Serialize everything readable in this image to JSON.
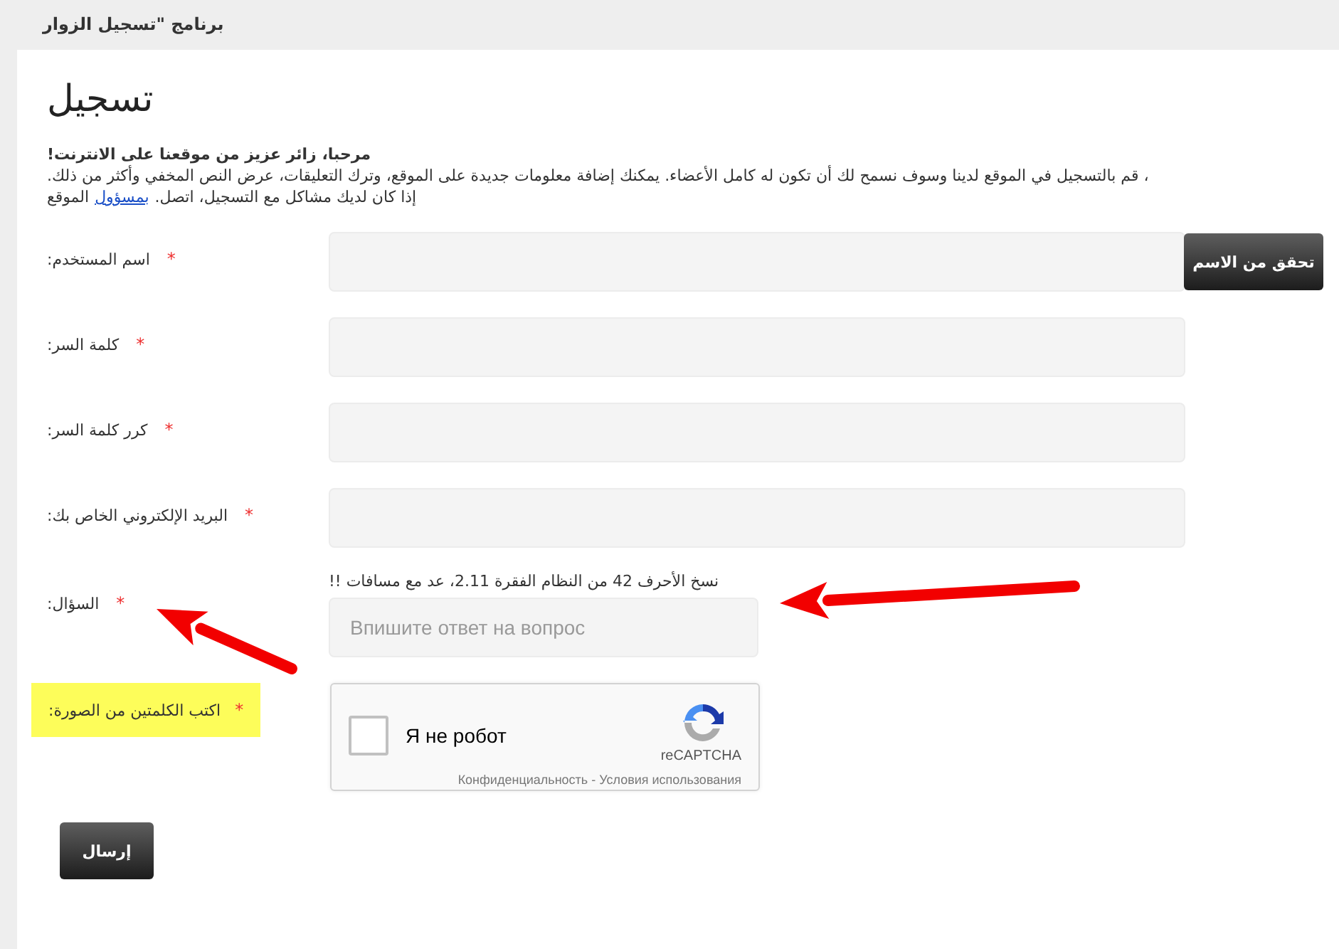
{
  "header": {
    "title": "برنامج \"تسجيل الزوار"
  },
  "page": {
    "heading": "تسجيل",
    "greeting": "!مرحبا، زائر عزيز من موقعنا على الانترنت",
    "intro": ".قم بالتسجيل في الموقع لدينا وسوف نسمح لك أن تكون له كامل الأعضاء. يمكنك إضافة معلومات جديدة على الموقع، وترك التعليقات، عرض النص المخفي وأكثر من ذلك ،",
    "contact": {
      "before": ".إذا كان لديك مشاكل مع التسجيل، اتصل ",
      "link": "بمسؤول",
      "after": " الموقع"
    }
  },
  "fields": [
    {
      "kind": "text",
      "label": ":اسم المستخدم",
      "required": "*",
      "highlighted": false,
      "action": "تحقق من الاسم"
    },
    {
      "kind": "text",
      "label": ":كلمة السر",
      "required": "*",
      "highlighted": false
    },
    {
      "kind": "text",
      "label": ":كرر كلمة السر",
      "required": "*",
      "highlighted": false
    },
    {
      "kind": "text",
      "label": ":البريد الإلكتروني الخاص بك",
      "required": "*",
      "highlighted": false
    },
    {
      "kind": "question",
      "label": ":السؤال",
      "required": "*",
      "highlighted": false,
      "hint": "!! نسخ الأحرف 42 من النظام الفقرة 2.11، عد مع مسافات",
      "placeholder": "Впишите ответ на вопрос"
    },
    {
      "kind": "captcha",
      "label": ":اكتب الكلمتين من الصورة",
      "required": "*",
      "highlighted": true,
      "captcha": {
        "checkbox_label": "Я не робот",
        "checked": false,
        "brand": "reCAPTCHA",
        "links": "Конфиденциальность - Условия использования"
      }
    }
  ],
  "submit": "إرسال",
  "arrows": [
    {
      "kind": "arrow"
    },
    {
      "kind": "arrow"
    }
  ]
}
